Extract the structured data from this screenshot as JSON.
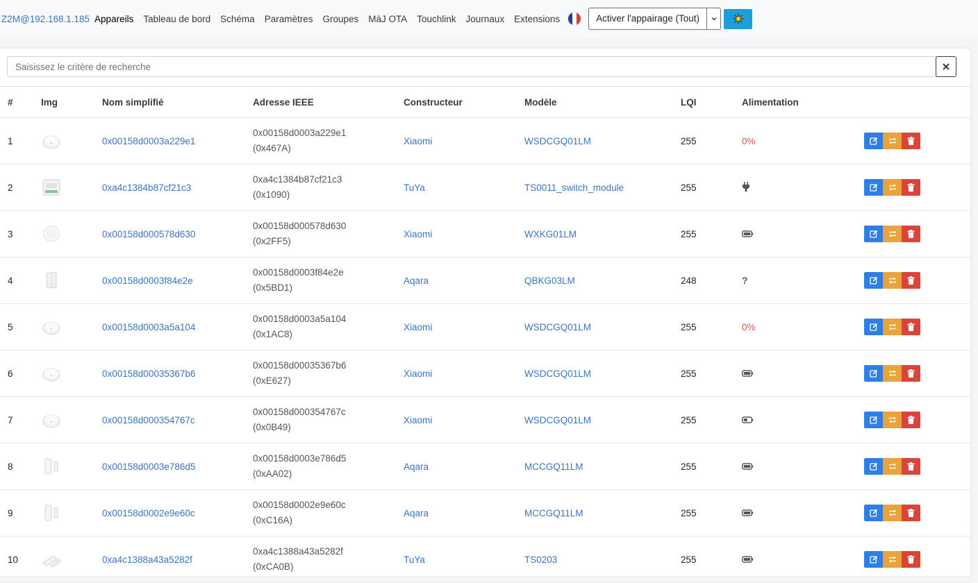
{
  "nav": {
    "brand": "Z2M@192.168.1.185",
    "links": [
      "Appareils",
      "Tableau de bord",
      "Schéma",
      "Paramètres",
      "Groupes",
      "MàJ OTA",
      "Touchlink",
      "Journaux",
      "Extensions"
    ],
    "language_icon": "french-flag-icon",
    "pair_label": "Activer l'appairage (Tout)",
    "theme_icon": "sun-icon"
  },
  "search": {
    "placeholder": "Saisissez le critère de recherche",
    "value": "",
    "clear_icon": "close-icon"
  },
  "table": {
    "headers": [
      "#",
      "Img",
      "Nom simplifié",
      "Adresse IEEE",
      "Constructeur",
      "Modèle",
      "LQI",
      "Alimentation"
    ],
    "rows": [
      {
        "num": "1",
        "img": "round-sensor",
        "name": "0x00158d0003a229e1",
        "ieee": "0x00158d0003a229e1",
        "nwk": "(0x467A)",
        "vendor": "Xiaomi",
        "model": "WSDCGQ01LM",
        "lqi": "255",
        "power": "0%"
      },
      {
        "num": "2",
        "img": "switch-module",
        "name": "0xa4c1384b87cf21c3",
        "ieee": "0xa4c1384b87cf21c3",
        "nwk": "(0x1090)",
        "vendor": "TuYa",
        "model": "TS0011_switch_module",
        "lqi": "255",
        "power": "plug-icon"
      },
      {
        "num": "3",
        "img": "round-button",
        "name": "0x00158d000578d630",
        "ieee": "0x00158d000578d630",
        "nwk": "(0x2FF5)",
        "vendor": "Xiaomi",
        "model": "WXKG01LM",
        "lqi": "255",
        "power": "battery-full-icon"
      },
      {
        "num": "4",
        "img": "wall-switch",
        "name": "0x00158d0003f84e2e",
        "ieee": "0x00158d0003f84e2e",
        "nwk": "(0x5BD1)",
        "vendor": "Aqara",
        "model": "QBKG03LM",
        "lqi": "248",
        "power": "?"
      },
      {
        "num": "5",
        "img": "round-sensor",
        "name": "0x00158d0003a5a104",
        "ieee": "0x00158d0003a5a104",
        "nwk": "(0x1AC8)",
        "vendor": "Xiaomi",
        "model": "WSDCGQ01LM",
        "lqi": "255",
        "power": "0%"
      },
      {
        "num": "6",
        "img": "round-sensor",
        "name": "0x00158d00035367b6",
        "ieee": "0x00158d00035367b6",
        "nwk": "(0xE627)",
        "vendor": "Xiaomi",
        "model": "WSDCGQ01LM",
        "lqi": "255",
        "power": "battery-full-icon"
      },
      {
        "num": "7",
        "img": "round-sensor",
        "name": "0x00158d000354767c",
        "ieee": "0x00158d000354767c",
        "nwk": "(0x0B49)",
        "vendor": "Xiaomi",
        "model": "WSDCGQ01LM",
        "lqi": "255",
        "power": "battery-half-icon"
      },
      {
        "num": "8",
        "img": "door-sensor",
        "name": "0x00158d0003e786d5",
        "ieee": "0x00158d0003e786d5",
        "nwk": "(0xAA02)",
        "vendor": "Aqara",
        "model": "MCCGQ11LM",
        "lqi": "255",
        "power": "battery-full-icon"
      },
      {
        "num": "9",
        "img": "door-sensor",
        "name": "0x00158d0002e9e60c",
        "ieee": "0x00158d0002e9e60c",
        "nwk": "(0xC16A)",
        "vendor": "Aqara",
        "model": "MCCGQ11LM",
        "lqi": "255",
        "power": "battery-full-icon"
      },
      {
        "num": "10",
        "img": "tuya-door-sensor",
        "name": "0xa4c1388a43a5282f",
        "ieee": "0xa4c1388a43a5282f",
        "nwk": "(0xCA0B)",
        "vendor": "TuYa",
        "model": "TS0203",
        "lqi": "255",
        "power": "battery-full-icon"
      }
    ],
    "action_icons": [
      "edit-icon",
      "rename-icon",
      "trash-icon"
    ]
  },
  "colors": {
    "link": "#3a75c4",
    "edit": "#2d7fe6",
    "rename": "#e8a43a",
    "delete": "#d9453a",
    "theme": "#1e9ed9",
    "warning_text": "#e55353"
  }
}
